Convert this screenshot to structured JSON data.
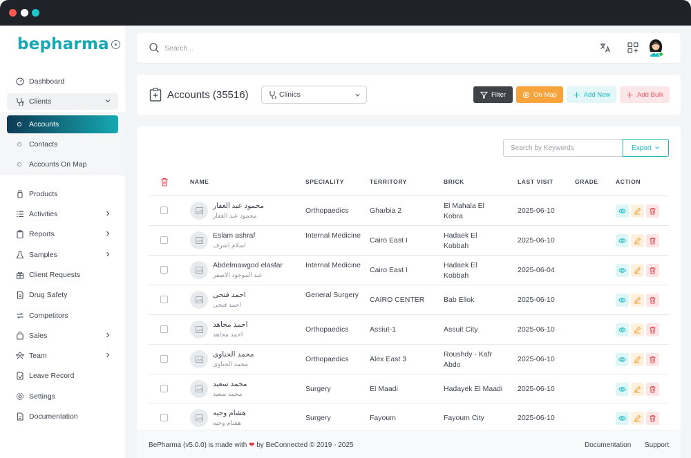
{
  "window": {
    "title": ""
  },
  "colors": {
    "brand": "#17a8b4",
    "active_grad_start": "#0f3a55",
    "active_grad_end": "#15a9b1",
    "filter_bg": "#3f4348",
    "map_bg": "#f8a43d",
    "add_text": "#19b8c2",
    "bulk_text": "#ea5a63"
  },
  "sidebar": {
    "logo": "bepharma",
    "items": [
      {
        "label": "Dashboard",
        "icon": "dashboard-icon"
      },
      {
        "label": "Clients",
        "icon": "stethoscope-icon",
        "expanded": true
      },
      {
        "label": "Products",
        "icon": "bottle-icon"
      },
      {
        "label": "Activities",
        "icon": "list-icon"
      },
      {
        "label": "Reports",
        "icon": "clipboard-icon"
      },
      {
        "label": "Samples",
        "icon": "flask-icon"
      },
      {
        "label": "Client Requests",
        "icon": "gift-icon"
      },
      {
        "label": "Drug Safety",
        "icon": "document-icon"
      },
      {
        "label": "Competitors",
        "icon": "compare-icon"
      },
      {
        "label": "Sales",
        "icon": "bag-icon"
      },
      {
        "label": "Team",
        "icon": "team-icon"
      },
      {
        "label": "Leave Record",
        "icon": "leave-icon"
      },
      {
        "label": "Settings",
        "icon": "gear-icon"
      },
      {
        "label": "Documentation",
        "icon": "file-icon"
      }
    ],
    "subitems": [
      {
        "label": "Accounts",
        "active": true
      },
      {
        "label": "Contacts"
      },
      {
        "label": "Accounts On Map"
      }
    ]
  },
  "topbar": {
    "search_placeholder": "Search..."
  },
  "header": {
    "title": "Accounts (35516)",
    "select_value": "Clinics",
    "filter": "Filter",
    "on_map": "On Map",
    "add_new": "Add New",
    "add_bulk": "Add Bulk"
  },
  "table": {
    "keyword_placeholder": "Search by Keywords",
    "export": "Export",
    "columns": [
      "NAME",
      "SPECIALITY",
      "TERRITORY",
      "BRICK",
      "LAST VISIT",
      "GRADE",
      "ACTION"
    ],
    "rows": [
      {
        "name": "محمود عبد الغفار",
        "name_ar": "محمود عبد الغفار",
        "speciality": "Orthopaedics",
        "territory": "Gharbia 2",
        "brick": "El Mahala El Kobra",
        "last_visit": "2025-06-10",
        "grade": ""
      },
      {
        "name": "Eslam ashraf",
        "name_ar": "اسلام اشرف",
        "speciality": "Internal Medicine",
        "territory": "Cairo East I",
        "brick": "Hadaek El Kobbah",
        "last_visit": "2025-06-10",
        "grade": ""
      },
      {
        "name": "Abdelmawgod elasfar",
        "name_ar": "عبد الموجود الاصفر",
        "speciality": "Internal Medicine",
        "territory": "Cairo East I",
        "brick": "Hadaek El Kobbah",
        "last_visit": "2025-06-04",
        "grade": ""
      },
      {
        "name": "احمد فتحى",
        "name_ar": "احمد فتحى",
        "speciality": "General Surgery",
        "territory": "CAIRO CENTER",
        "brick": "Bab Ellok",
        "last_visit": "2025-06-10",
        "grade": ""
      },
      {
        "name": "احمد مجاهد",
        "name_ar": "احمد مجاهد",
        "speciality": "Orthopaedics",
        "territory": "Assiut-1",
        "brick": "Assuit City",
        "last_visit": "2025-06-10",
        "grade": ""
      },
      {
        "name": "محمد الحناوى",
        "name_ar": "محمد الحناوى",
        "speciality": "Orthopaedics",
        "territory": "Alex East 3",
        "brick": "Roushdy - Kafr Abdo",
        "last_visit": "2025-06-10",
        "grade": ""
      },
      {
        "name": "محمد سعيد",
        "name_ar": "محمد سعيد",
        "speciality": "Surgery",
        "territory": "El Maadi",
        "brick": "Hadayek El Maadi",
        "last_visit": "2025-06-10",
        "grade": ""
      },
      {
        "name": "هشام وجيه",
        "name_ar": "هشام وجيه",
        "speciality": "Surgery",
        "territory": "Fayoum",
        "brick": "Fayoum City",
        "last_visit": "2025-06-10",
        "grade": ""
      }
    ]
  },
  "footer": {
    "text_before": "BePharma (v5.0.0) is made with",
    "text_after": "by BeConnected © 2019 - 2025",
    "documentation": "Documentation",
    "support": "Support"
  }
}
